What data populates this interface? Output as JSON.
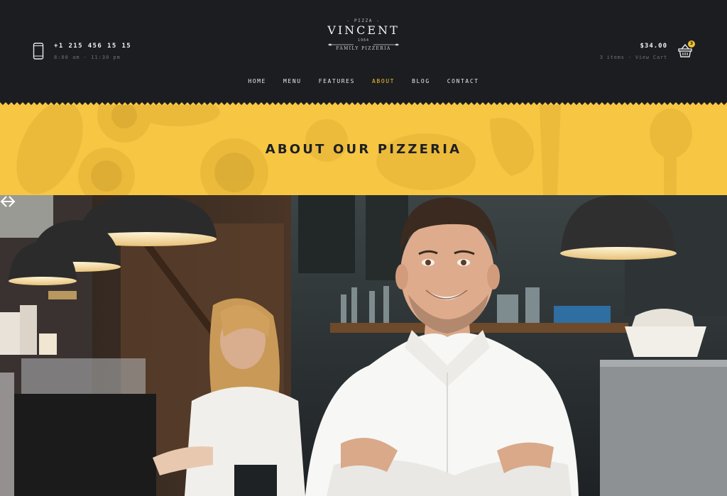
{
  "header": {
    "phone_number": "+1 215 456 15 15",
    "phone_hours": "8:00 am - 11:30 pm",
    "phone_icon": "smartphone-icon"
  },
  "logo": {
    "top": "- PIZZA -",
    "name": "VINCENT",
    "year": "1964",
    "bottom": "FAMILY PIZZERIA"
  },
  "cart": {
    "total": "$34.00",
    "meta": "3 items - View Cart",
    "badge": "3",
    "icon": "shopping-basket-icon"
  },
  "nav": {
    "items": [
      {
        "label": "HOME"
      },
      {
        "label": "MENU"
      },
      {
        "label": "FEATURES"
      },
      {
        "label": "ABOUT",
        "active": true
      },
      {
        "label": "BLOG"
      },
      {
        "label": "CONTACT"
      }
    ]
  },
  "banner": {
    "title": "ABOUT OUR PIZZERIA"
  },
  "slider": {
    "prev_icon": "arrow-left-icon",
    "next_icon": "arrow-right-icon"
  },
  "colors": {
    "header_bg": "#1b1d20",
    "accent": "#f2c12e",
    "banner_bg": "#f7c744"
  }
}
